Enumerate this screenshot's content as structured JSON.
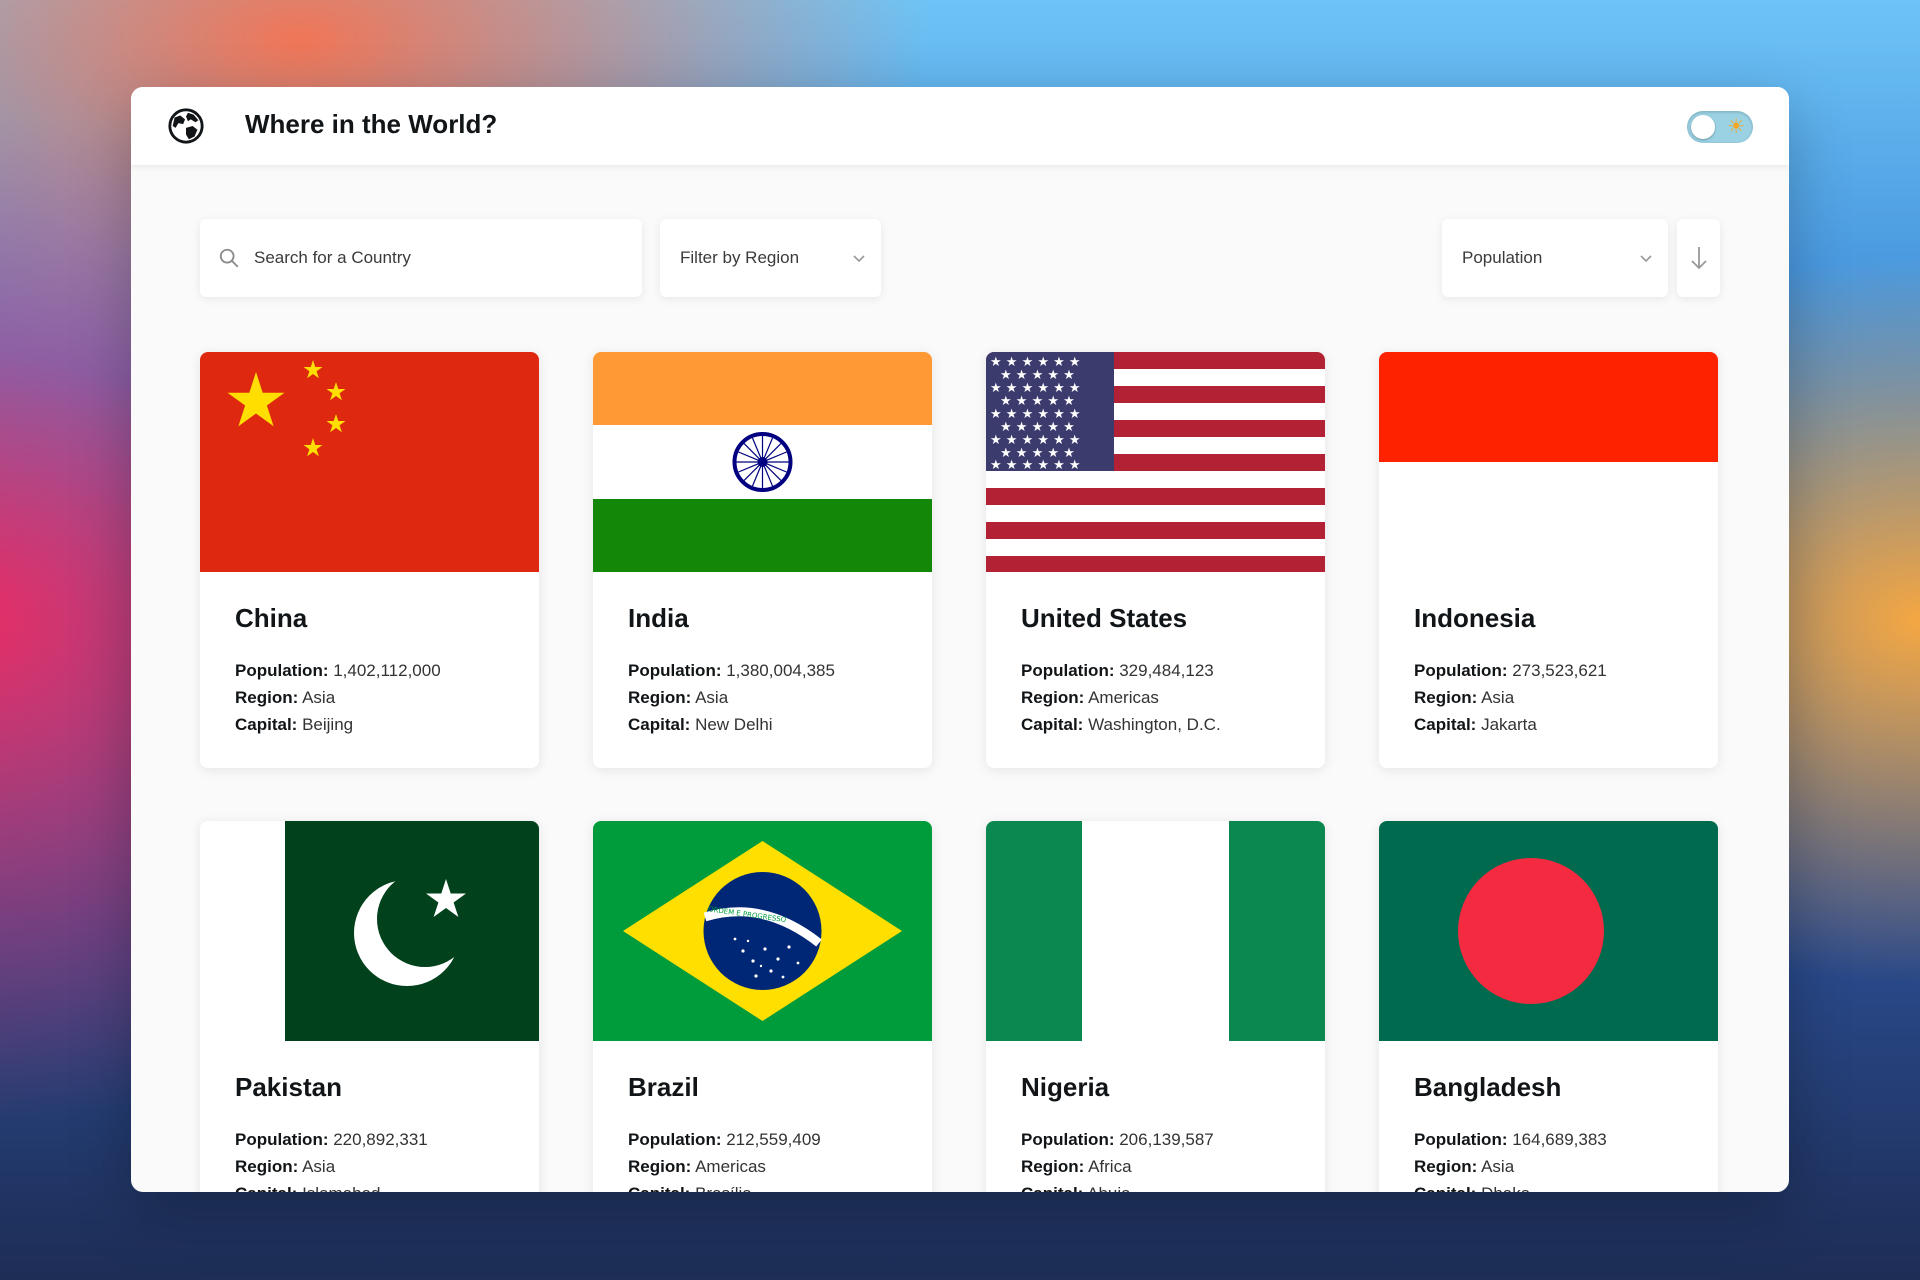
{
  "header": {
    "title": "Where in the World?",
    "theme_toggle_icon": "sun-icon"
  },
  "search": {
    "placeholder": "Search for a Country",
    "value": ""
  },
  "filter": {
    "label": "Filter by Region"
  },
  "sort": {
    "label": "Population",
    "order_icon": "arrow-down-icon"
  },
  "labels": {
    "population": "Population:",
    "region": "Region:",
    "capital": "Capital:"
  },
  "countries": [
    {
      "name": "China",
      "population": "1,402,112,000",
      "region": "Asia",
      "capital": "Beijing"
    },
    {
      "name": "India",
      "population": "1,380,004,385",
      "region": "Asia",
      "capital": "New Delhi"
    },
    {
      "name": "United States",
      "population": "329,484,123",
      "region": "Americas",
      "capital": "Washington, D.C."
    },
    {
      "name": "Indonesia",
      "population": "273,523,621",
      "region": "Asia",
      "capital": "Jakarta"
    },
    {
      "name": "Pakistan",
      "population": "220,892,331",
      "region": "Asia",
      "capital": "Islamabad"
    },
    {
      "name": "Brazil",
      "population": "212,559,409",
      "region": "Americas",
      "capital": "Brasília"
    },
    {
      "name": "Nigeria",
      "population": "206,139,587",
      "region": "Africa",
      "capital": "Abuja"
    },
    {
      "name": "Bangladesh",
      "population": "164,689,383",
      "region": "Asia",
      "capital": "Dhaka"
    }
  ],
  "brazil_flag_motto": "ORDEM E PROGRESSO"
}
